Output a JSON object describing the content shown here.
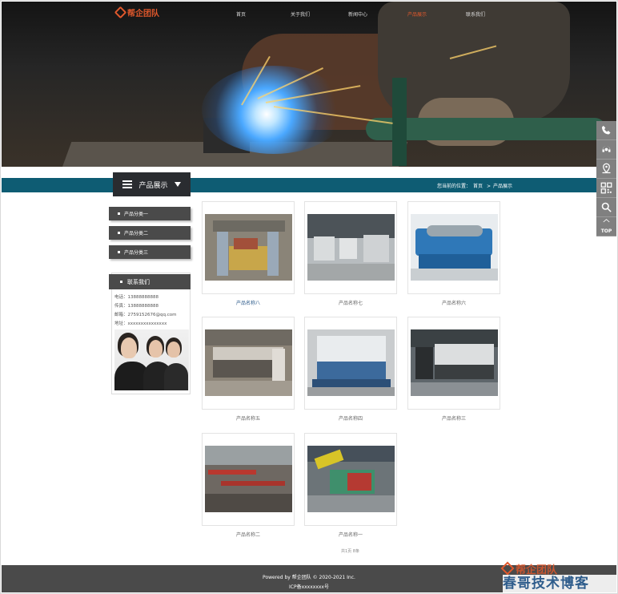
{
  "header": {
    "logo_text": "帮企团队",
    "menu": [
      {
        "label": "首页",
        "active": false
      },
      {
        "label": "关于我们",
        "active": false
      },
      {
        "label": "新闻中心",
        "active": false
      },
      {
        "label": "产品展示",
        "active": true
      },
      {
        "label": "联系我们",
        "active": false
      }
    ]
  },
  "breadcrumb": {
    "prefix": "您当前的位置：",
    "home": "首页",
    "separator": ">",
    "current": "产品展示"
  },
  "sidebar": {
    "title": "产品展示",
    "categories": [
      "产品分类一",
      "产品分类二",
      "产品分类三"
    ],
    "contact_title": "联系我们",
    "contact_lines": [
      "电话：13888888888",
      "传真：13888888888",
      "邮箱：2759152676@qq.com",
      "地址：xxxxxxxxxxxxxxx"
    ]
  },
  "products": [
    {
      "name": "产品名称八",
      "highlight": true
    },
    {
      "name": "产品名称七",
      "highlight": false
    },
    {
      "name": "产品名称六",
      "highlight": false
    },
    {
      "name": "产品名称五",
      "highlight": false
    },
    {
      "name": "产品名称四",
      "highlight": false
    },
    {
      "name": "产品名称三",
      "highlight": false
    },
    {
      "name": "产品名称二",
      "highlight": false
    },
    {
      "name": "产品名称一",
      "highlight": false
    }
  ],
  "pagination": {
    "text": "共1页 8条"
  },
  "side_tools": {
    "icons": [
      "phone-icon",
      "headset-icon",
      "location-icon",
      "qrcode-icon",
      "search-icon",
      "top-icon"
    ],
    "top_label": "TOP"
  },
  "footer": {
    "copyright": "Powered by 帮企团队 © 2020-2021 Inc.",
    "icp": "ICP备xxxxxxxx号"
  },
  "watermark": {
    "logo_text": "帮企团队",
    "text": "春哥技术博客"
  },
  "colors": {
    "accent": "#e0582c",
    "teal_bar": "#0e5c73",
    "dark": "#2a2c30",
    "link_blue": "#2f5d8c"
  }
}
